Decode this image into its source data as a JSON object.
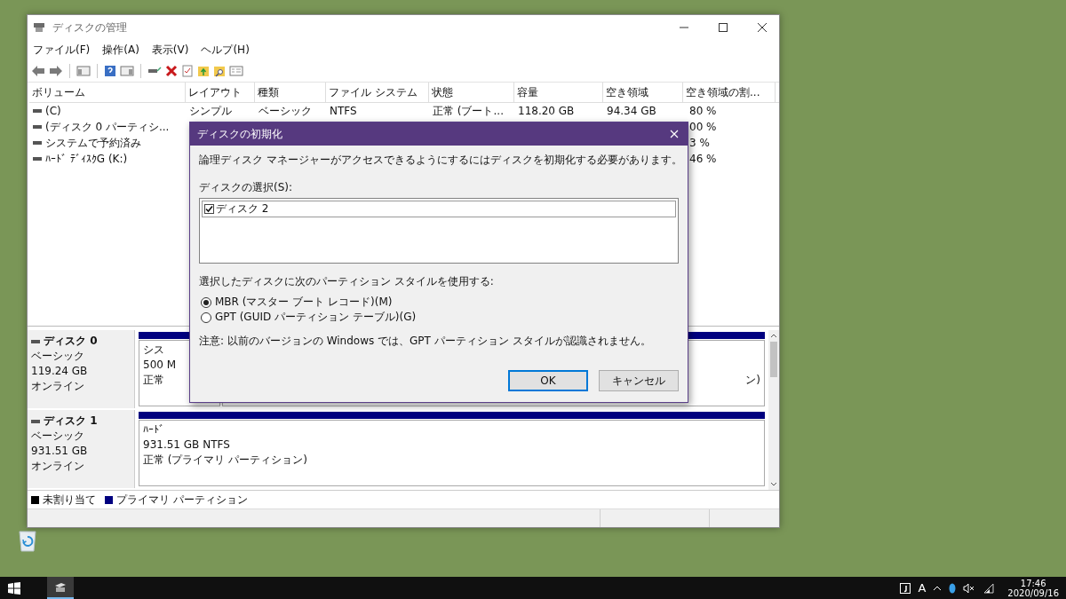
{
  "window": {
    "title": "ディスクの管理",
    "menu": [
      "ファイル(F)",
      "操作(A)",
      "表示(V)",
      "ヘルプ(H)"
    ],
    "volume_table": {
      "columns": [
        "ボリューム",
        "レイアウト",
        "種類",
        "ファイル システム",
        "状態",
        "容量",
        "空き領域",
        "空き領域の割..."
      ],
      "rows": [
        {
          "volume": "(C)",
          "details": [
            "シンプル",
            "ベーシック",
            "NTFS",
            "正常 (ブート...",
            "118.20 GB",
            "94.34 GB"
          ],
          "free_share": "80 %"
        },
        {
          "volume": "(ディスク 0 パーティシ...",
          "free_share": "00 %"
        },
        {
          "volume": "システムで予約済み",
          "free_share": "3 %"
        },
        {
          "volume": "ﾊｰﾄﾞ ﾃﾞｨｽｸG (K:)",
          "free_share": "46 %"
        }
      ]
    },
    "disks": [
      {
        "name": "ディスク 0",
        "type": "ベーシック",
        "size": "119.24 GB",
        "status": "オンライン",
        "partitions": [
          {
            "kind": "primary",
            "lines": [
              "シス",
              "500 M",
              "正常"
            ]
          },
          {
            "kind": "primary",
            "tail": "ン)"
          }
        ]
      },
      {
        "name": "ディスク 1",
        "type": "ベーシック",
        "size": "931.51 GB",
        "status": "オンライン",
        "partitions": [
          {
            "kind": "primary",
            "lines": [
              "ﾊｰﾄﾞ",
              "931.51 GB NTFS",
              "正常 (プライマリ パーティション)"
            ]
          }
        ]
      }
    ],
    "legend": [
      {
        "label": "未割り当て",
        "color": "#000000"
      },
      {
        "label": "プライマリ パーティション",
        "color": "#00007f"
      }
    ]
  },
  "dialog": {
    "title": "ディスクの初期化",
    "message": "論理ディスク マネージャーがアクセスできるようにするにはディスクを初期化する必要があります。",
    "list_label": "ディスクの選択(S):",
    "disks": [
      {
        "label": "ディスク 2",
        "checked": true
      }
    ],
    "style_label": "選択したディスクに次のパーティション スタイルを使用する:",
    "styles": [
      {
        "label": "MBR (マスター ブート レコード)(M)",
        "selected": true
      },
      {
        "label": "GPT (GUID パーティション テーブル)(G)",
        "selected": false
      }
    ],
    "note": "注意: 以前のバージョンの Windows では、GPT パーティション スタイルが認識されません。",
    "buttons": [
      {
        "label": "OK",
        "default": true
      },
      {
        "label": "キャンセル",
        "default": false
      }
    ]
  },
  "taskbar": {
    "input_mode": "A",
    "time": "17:46",
    "date": "2020/09/16"
  }
}
